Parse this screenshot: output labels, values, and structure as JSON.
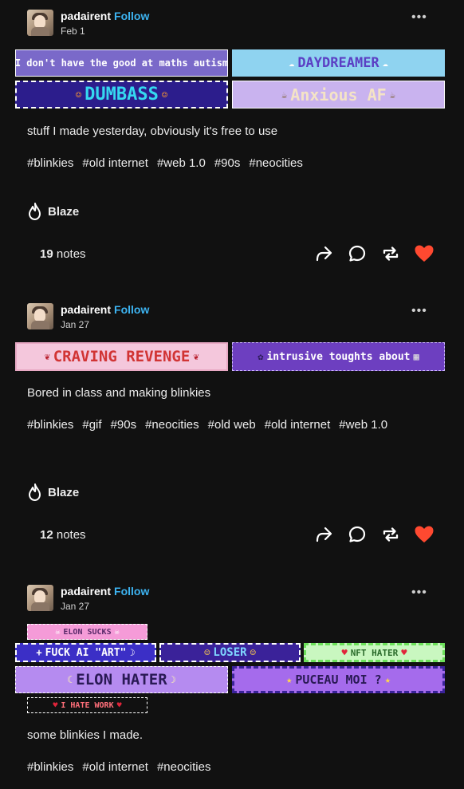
{
  "posts": [
    {
      "username": "padairent",
      "follow_label": "Follow",
      "date": "Feb 1",
      "more_label": "•••",
      "blinkies": [
        {
          "text": "I don't have the good at maths autism",
          "icon_left": "✧",
          "icon_right": "✧",
          "bg": "#7a69c9",
          "fg": "#ffffff"
        },
        {
          "text": "DAYDREAMER",
          "icon_left": "☁",
          "icon_right": "☁",
          "bg": "#8fd3f0",
          "fg": "#5b3fc4"
        },
        {
          "text": "DUMBASS",
          "icon_left": "☺",
          "icon_right": "☺",
          "bg": "#2c1d8c",
          "fg": "#35d8f0"
        },
        {
          "text": "Anxious AF",
          "icon_left": "☕",
          "icon_right": "☕",
          "bg": "#c9b3ef",
          "fg": "#f4e3c6"
        }
      ],
      "text": "stuff I made yesterday, obviously it's free to use",
      "tags": [
        "#blinkies",
        "#old internet",
        "#web 1.0",
        "#90s",
        "#neocities"
      ],
      "blaze_label": "Blaze",
      "notes_count": "19",
      "notes_label": "notes"
    },
    {
      "username": "padairent",
      "follow_label": "Follow",
      "date": "Jan 27",
      "more_label": "•••",
      "blinkies": [
        {
          "text": "CRAVING REVENGE",
          "icon_left": "❦",
          "icon_right": "❦",
          "bg": "#f4c7dc",
          "fg": "#d13434"
        },
        {
          "text": "intrusive toughts about",
          "icon_left": "✿",
          "icon_right": "▦",
          "bg": "#6d3fc0",
          "fg": "#ffffff"
        }
      ],
      "text": "Bored in class and making blinkies",
      "tags": [
        "#blinkies",
        "#gif",
        "#90s",
        "#neocities",
        "#old web",
        "#old internet",
        "#web 1.0"
      ],
      "blaze_label": "Blaze",
      "notes_count": "12",
      "notes_label": "notes"
    },
    {
      "username": "padairent",
      "follow_label": "Follow",
      "date": "Jan 27",
      "more_label": "•••",
      "blinkies": [
        {
          "text": "ELON SUCKS",
          "icon_left": "☠",
          "icon_right": "☠",
          "bg": "#f59bd8",
          "fg": "#5a2a6a"
        },
        {
          "text": "FUCK AI \"ART\"",
          "icon_left": "+",
          "icon_right": "☽",
          "bg": "#3b2fc6",
          "fg": "#ffffff"
        },
        {
          "text": "LOSER",
          "icon_left": "☺",
          "icon_right": "☺",
          "bg": "#3a2299",
          "fg": "#7fd6ff"
        },
        {
          "text": "NFT HATER",
          "icon_left": "♥",
          "icon_right": "♥",
          "bg": "#c9f7c0",
          "fg": "#2a6a2a"
        },
        {
          "text": "ELON HATER",
          "icon_left": "☾",
          "icon_right": "☽",
          "bg": "#b58bf0",
          "fg": "#2a1a55"
        },
        {
          "text": "PUCEAU MOI ?",
          "icon_left": "★",
          "icon_right": "★",
          "bg": "#a56bec",
          "fg": "#2a1a55"
        },
        {
          "text": "I HATE WORK",
          "icon_left": "♥",
          "icon_right": "♥",
          "bg": "#111111",
          "fg": "#ff6f7a"
        }
      ],
      "text": "some blinkies I made.",
      "tags": [
        "#blinkies",
        "#old internet",
        "#neocities"
      ]
    }
  ]
}
